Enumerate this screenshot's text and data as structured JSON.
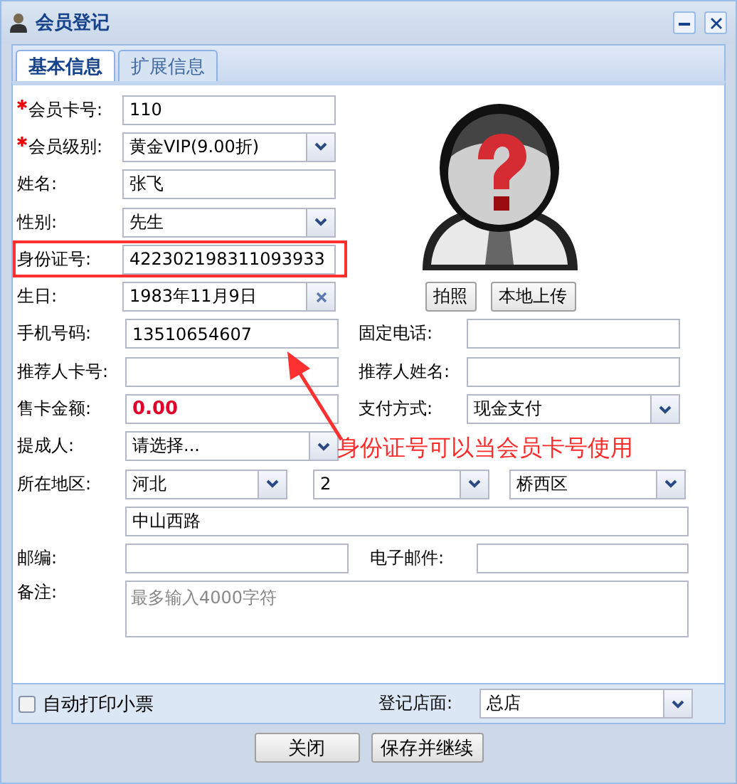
{
  "window": {
    "title": "会员登记"
  },
  "tabs": [
    {
      "label": "基本信息",
      "selected": true
    },
    {
      "label": "扩展信息",
      "selected": false
    }
  ],
  "main_fields": [
    {
      "label": "会员卡号:",
      "required": true,
      "kind": "text",
      "value": "110",
      "highlighted": false
    },
    {
      "label": "会员级别:",
      "required": true,
      "kind": "select",
      "value": "黄金VIP(9.00折)",
      "highlighted": false
    },
    {
      "label": "姓名:",
      "required": false,
      "kind": "text",
      "value": "张飞",
      "highlighted": false
    },
    {
      "label": "性别:",
      "required": false,
      "kind": "select",
      "value": "先生",
      "highlighted": false
    },
    {
      "label": "身份证号:",
      "required": false,
      "kind": "text",
      "value": "422302198311093933",
      "highlighted": true
    },
    {
      "label": "生日:",
      "required": false,
      "kind": "date",
      "value": "1983年11月9日",
      "highlighted": false
    }
  ],
  "photo": {
    "buttons": [
      "拍照",
      "本地上传"
    ]
  },
  "paired_rows": [
    [
      {
        "label": "手机号码:",
        "kind": "text",
        "value": "13510654607"
      },
      {
        "label": "固定电话:",
        "kind": "text"
      }
    ],
    [
      {
        "label": "推荐人卡号:",
        "kind": "text"
      },
      {
        "label": "推荐人姓名:",
        "kind": "text"
      }
    ],
    [
      {
        "label": "售卡金额:",
        "kind": "amount",
        "value": "0.00"
      },
      {
        "label": "支付方式:",
        "kind": "select",
        "value": "现金支付"
      }
    ],
    [
      {
        "label": "提成人:",
        "kind": "select",
        "value": "请选择..."
      }
    ]
  ],
  "region": {
    "label": "所在地区:",
    "selects": [
      "河北",
      "2",
      "桥西区"
    ],
    "address": "中山西路"
  },
  "contact_row": [
    {
      "label": "邮编:"
    },
    {
      "label": "电子邮件:"
    }
  ],
  "remark": {
    "label": "备注:",
    "placeholder": "最多输入4000字符"
  },
  "footer": {
    "auto_print": {
      "label": "自动打印小票",
      "checked": false
    },
    "store": {
      "label": "登记店面:",
      "value": "总店"
    }
  },
  "buttons": [
    "关闭",
    "保存并继续"
  ],
  "annotation": {
    "text": "身份证号可以当会员卡号使用"
  }
}
